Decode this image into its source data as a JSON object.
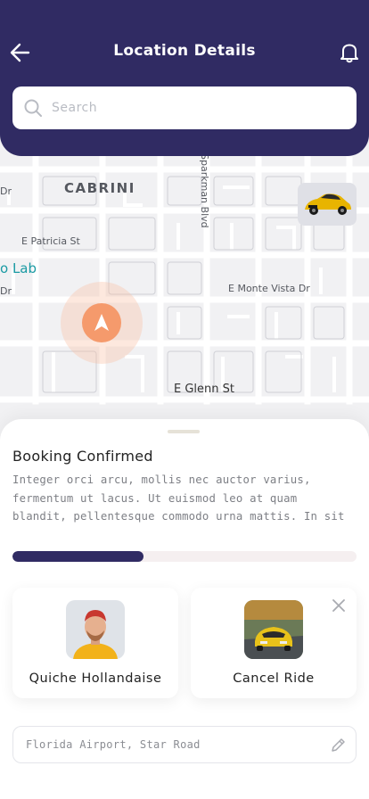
{
  "header": {
    "title": "Location Details",
    "back_icon": "arrow-left-icon",
    "notification_icon": "bell-icon",
    "background_color": "#302b63"
  },
  "search": {
    "placeholder": "Search",
    "value": ""
  },
  "map": {
    "labels": {
      "neighborhood": "CABRINI",
      "street_patricia": "E Patricia St",
      "street_sparkman": "Sparkman Blvd",
      "street_monte_vista": "E Monte Vista Dr",
      "street_glenn": "E Glenn St",
      "poi_lab": "o Lab",
      "dr_top": "Dr",
      "dr_mid": "Dr"
    },
    "marker_icon": "navigation-arrow-icon",
    "marker_color": "#f59a6c",
    "car_icon": "car-icon"
  },
  "sheet": {
    "title": "Booking Confirmed",
    "description": "Integer orci arcu, mollis nec auctor varius, fermentum ut lacus. Ut euismod leo at quam blandit, pellentesque commodo urna mattis. In sit",
    "progress_percent": 38,
    "progress_color": "#302b63"
  },
  "cards": {
    "driver": {
      "label": "Quiche Hollandaise",
      "image": "driver-avatar"
    },
    "cancel": {
      "label": "Cancel Ride",
      "image": "car-photo",
      "close_icon": "close-icon"
    }
  },
  "address": {
    "value": "Florida Airport, Star Road",
    "edit_icon": "pencil-icon"
  }
}
